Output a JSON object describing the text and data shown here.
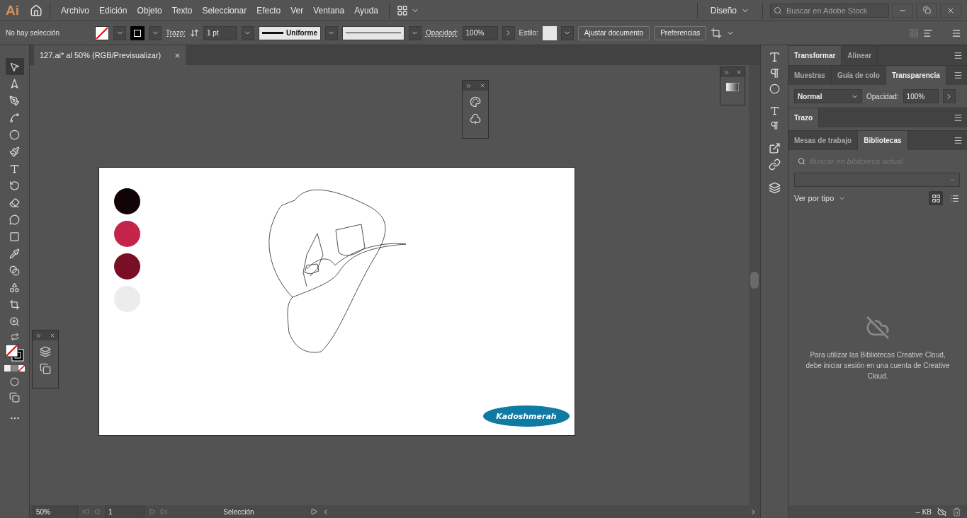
{
  "app": {
    "logo": "Ai",
    "menu": [
      "Archivo",
      "Edición",
      "Objeto",
      "Texto",
      "Seleccionar",
      "Efecto",
      "Ver",
      "Ventana",
      "Ayuda"
    ],
    "workspace": "Diseño",
    "stock_search": {
      "placeholder": "Buscar en Adobe Stock"
    }
  },
  "control_bar": {
    "selection": "No hay selección",
    "stroke_label": "Trazo:",
    "stroke_weight": "1 pt",
    "profile": "Uniforme",
    "opacity_label": "Opacidad:",
    "opacity": "100%",
    "style_label": "Estilo:",
    "buttons": [
      "Ajustar documento",
      "Preferencias"
    ]
  },
  "document_tab": {
    "title": "127.ai* al 50% (RGB/Previsualizar)",
    "close": "×"
  },
  "tools": [
    {
      "kind": "select",
      "selected": true
    },
    {
      "kind": "direct",
      "selected": false
    },
    {
      "kind": "pen",
      "selected": false
    },
    {
      "kind": "curvature",
      "selected": false
    },
    {
      "kind": "ellipse",
      "selected": false
    },
    {
      "kind": "brush",
      "selected": false
    },
    {
      "kind": "type",
      "selected": false
    },
    {
      "kind": "rotate",
      "selected": false
    },
    {
      "kind": "eraser",
      "selected": false
    },
    {
      "kind": "puppet",
      "selected": false
    },
    {
      "kind": "gradient",
      "selected": false
    },
    {
      "kind": "eyedropper",
      "selected": false
    },
    {
      "kind": "blend",
      "selected": false
    },
    {
      "kind": "shape",
      "selected": false
    },
    {
      "kind": "artboard",
      "selected": false
    },
    {
      "kind": "zoom",
      "selected": false
    }
  ],
  "swatches": [
    {
      "color": "#120406"
    },
    {
      "color": "#c4244a"
    },
    {
      "color": "#780f24"
    },
    {
      "color": "#ececec"
    }
  ],
  "signature": "Kadoshmerah",
  "panel_groups": [
    {
      "tabs": [
        {
          "label": "Transformar",
          "selected": true
        },
        {
          "label": "Alinear",
          "selected": false
        }
      ]
    },
    {
      "tabs": [
        {
          "label": "Muestras",
          "selected": false
        },
        {
          "label": "Guía de colo",
          "selected": false
        },
        {
          "label": "Transparencia",
          "selected": true
        }
      ]
    }
  ],
  "transparency": {
    "blend_mode": "Normal",
    "opacity_label": "Opacidad:",
    "opacity": "100%"
  },
  "stroke_panel": {
    "label": "Trazo"
  },
  "library_tabs": [
    {
      "label": "Mesas de trabajo",
      "selected": false
    },
    {
      "label": "Bibliotecas",
      "selected": true
    }
  ],
  "library": {
    "search_placeholder": "Buscar en biblioteca actual",
    "view_label": "Ver por tipo",
    "grid_view": {
      "selected": true
    },
    "list_view": {
      "selected": false
    },
    "message": "Para utilizar las Bibliotecas Creative Cloud, debe iniciar sesión en una cuenta de Creative Cloud.",
    "size": "-- KB"
  },
  "status_bar": {
    "zoom": "50%",
    "artboard": "1",
    "tool": "Selección"
  }
}
